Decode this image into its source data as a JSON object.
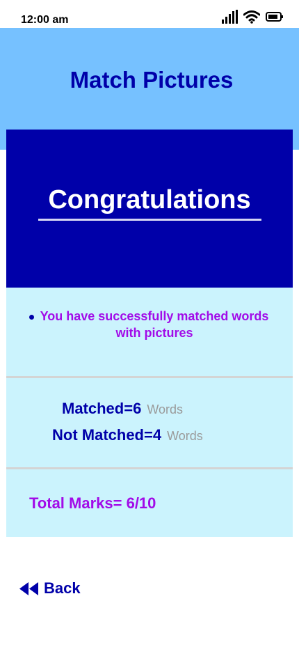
{
  "status_bar": {
    "time": "12:00 am",
    "icons": [
      "signal-icon",
      "wifi-icon",
      "battery-icon"
    ]
  },
  "header": {
    "title": "Match Pictures"
  },
  "result": {
    "heading": "Congratulations",
    "message": "You have successfully matched words with pictures",
    "stats": [
      {
        "value": "Matched=6",
        "unit": "Words"
      },
      {
        "value": "Not Matched=4",
        "unit": "Words"
      }
    ],
    "total": "Total Marks= 6/10"
  },
  "nav": {
    "back_label": "Back",
    "back_icon": "double-chevron-left-icon"
  },
  "colors": {
    "header_bg": "#76c1ff",
    "primary": "#0000a9",
    "accent_purple": "#a20be8",
    "panel_bg": "#cbf3fd",
    "muted": "#9a9a9a",
    "divider": "#d4d4d4"
  }
}
